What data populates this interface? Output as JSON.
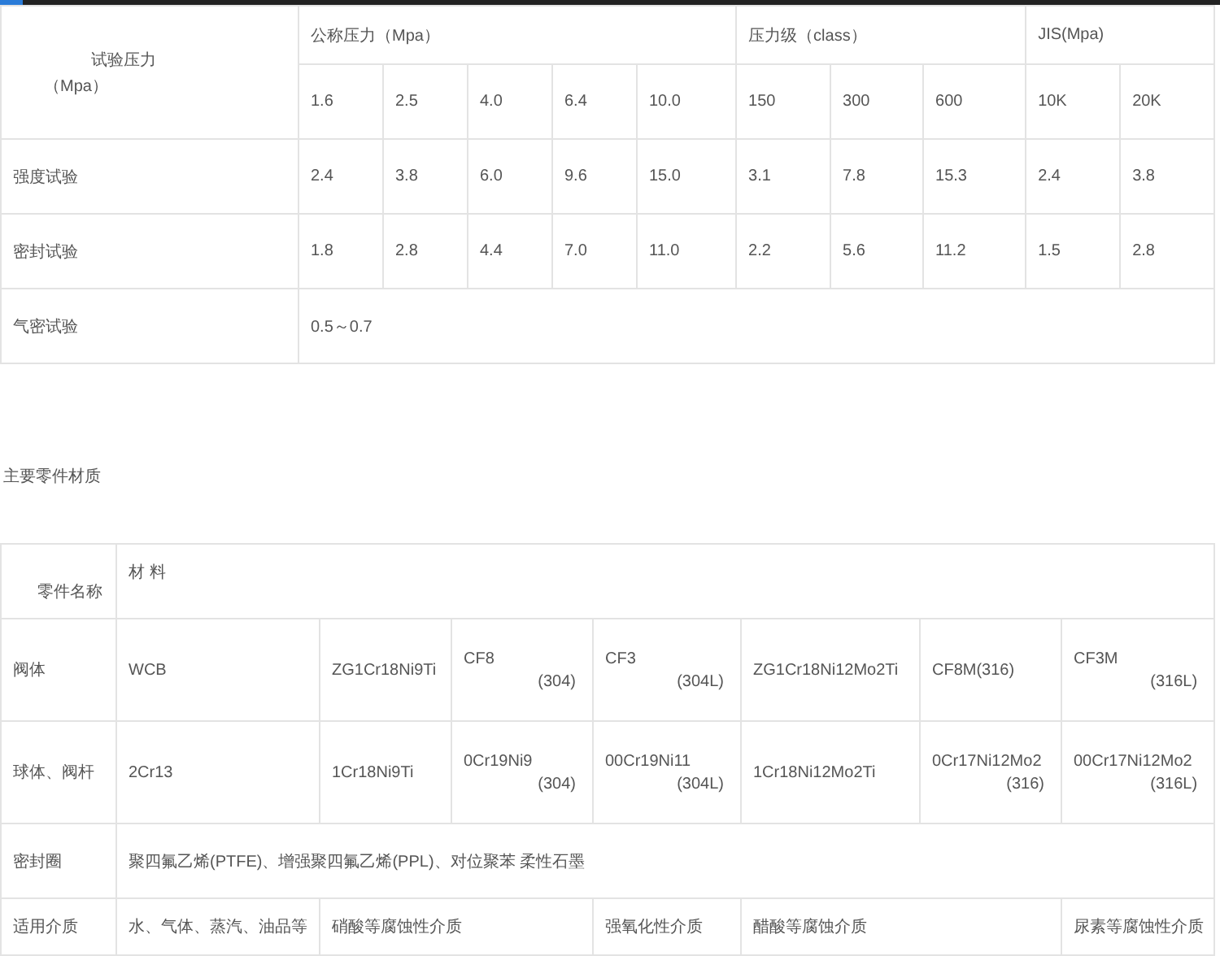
{
  "pressure_table": {
    "corner": [
      "试验压力",
      "（Mpa）"
    ],
    "groups": [
      {
        "label": "公称压力（Mpa）",
        "columns": [
          "1.6",
          "2.5",
          "4.0",
          "6.4",
          "10.0"
        ]
      },
      {
        "label": "压力级（class）",
        "columns": [
          "150",
          "300",
          "600"
        ]
      },
      {
        "label": "JIS(Mpa)",
        "columns": [
          "10K",
          "20K"
        ]
      }
    ],
    "rows": [
      {
        "label": "强度试验",
        "values": [
          "2.4",
          "3.8",
          "6.0",
          "9.6",
          "15.0",
          "3.1",
          "7.8",
          "15.3",
          "2.4",
          "3.8"
        ]
      },
      {
        "label": "密封试验",
        "values": [
          "1.8",
          "2.8",
          "4.4",
          "7.0",
          "11.0",
          "2.2",
          "5.6",
          "11.2",
          "1.5",
          "2.8"
        ]
      },
      {
        "label": "气密试验",
        "values": [
          "0.5～0.7"
        ]
      }
    ]
  },
  "materials_heading": "主要零件材质",
  "materials_table": {
    "corner": "零件名称",
    "title": "材 料",
    "rows": [
      {
        "label": "阀体",
        "cells": [
          {
            "kind": "single",
            "text": "WCB"
          },
          {
            "kind": "single",
            "text": "ZG1Cr18Ni9Ti"
          },
          {
            "kind": "single",
            "text": "CF8",
            "note": "(304)"
          },
          {
            "kind": "single",
            "text": "CF3",
            "note": "(304L)"
          },
          {
            "kind": "single",
            "text": "ZG1Cr18Ni12Mo2Ti"
          },
          {
            "kind": "single",
            "text": "CF8M(316)"
          },
          {
            "kind": "single",
            "text": "CF3M",
            "note": "(316L)"
          }
        ]
      },
      {
        "label": "球体、阀杆",
        "cells": [
          {
            "kind": "single",
            "text": "2Cr13"
          },
          {
            "kind": "single",
            "text": "1Cr18Ni9Ti"
          },
          {
            "kind": "single",
            "text": "0Cr19Ni9",
            "note": "(304)"
          },
          {
            "kind": "single",
            "text": "00Cr19Ni11",
            "note": "(304L)"
          },
          {
            "kind": "single",
            "text": "1Cr18Ni12Mo2Ti"
          },
          {
            "kind": "single",
            "text": "0Cr17Ni12Mo2",
            "note": "(316)"
          },
          {
            "kind": "single",
            "text": "00Cr17Ni12Mo2",
            "note": "(316L)"
          }
        ]
      },
      {
        "label": "密封圈",
        "value": "聚四氟乙烯(PTFE)、增强聚四氟乙烯(PPL)、对位聚苯 柔性石墨"
      },
      {
        "label": "适用介质",
        "cells": [
          {
            "kind": "single",
            "text": "水、气体、蒸汽、油品等"
          },
          {
            "kind": "double",
            "text": "硝酸等腐蚀性介质"
          },
          {
            "kind": "single",
            "text": "强氧化性介质"
          },
          {
            "kind": "double",
            "text": "醋酸等腐蚀介质"
          },
          {
            "kind": "single",
            "text": "尿素等腐蚀性介质"
          }
        ]
      }
    ]
  }
}
